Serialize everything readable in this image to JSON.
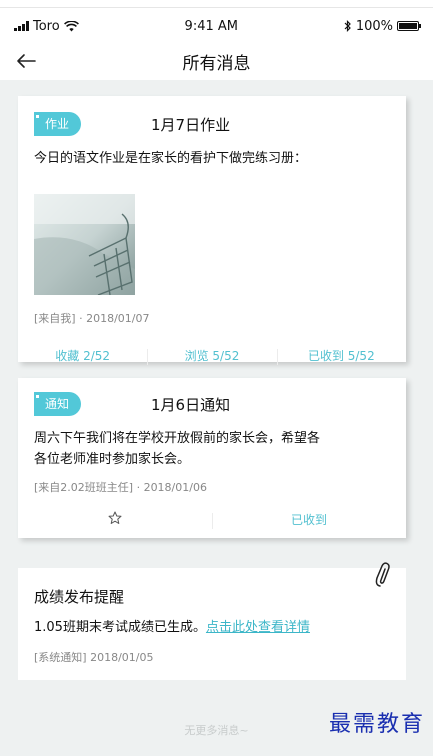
{
  "status": {
    "carrier": "Toro",
    "time": "9:41 AM",
    "battery": "100%"
  },
  "header": {
    "title": "所有消息"
  },
  "icons": {
    "back": "back-arrow-icon",
    "star": "star-icon",
    "clip": "paperclip-icon",
    "wifi": "wifi-icon",
    "bluetooth": "bluetooth-icon"
  },
  "colors": {
    "accent": "#52c8d8",
    "background": "#eef1f1"
  },
  "cards": [
    {
      "tag": "作业",
      "title": "1月7日作业",
      "body": "今日的语文作业是在家长的看护下做完练习册：",
      "meta": "[来自我] · 2018/01/07",
      "actions": [
        "收藏 2/52",
        "浏览 5/52",
        "已收到 5/52"
      ]
    },
    {
      "tag": "通知",
      "title": "1月6日通知",
      "body_lines": [
        "周六下午我们将在学校开放假前的家长会，希望各",
        "各位老师准时参加家长会。"
      ],
      "meta": "[来自2.02班班主任] · 2018/01/06",
      "actions": [
        "已收到"
      ]
    },
    {
      "title": "成绩发布提醒",
      "body": "1.05班期末考试成绩已生成。",
      "link": "点击此处查看详情",
      "meta": "[系统通知]   2018/01/05"
    }
  ],
  "footer": {
    "no_more": "无更多消息~"
  },
  "watermark": "最需教育"
}
